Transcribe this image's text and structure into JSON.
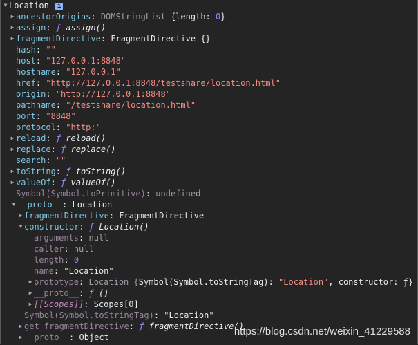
{
  "header": {
    "title": "Location",
    "badge": "i"
  },
  "own_props": [
    {
      "key": "ancestorOrigins",
      "type": "obj",
      "value": "DOMStringList {length: 0}"
    },
    {
      "key": "assign",
      "type": "fn",
      "fn_kw": "ƒ",
      "fn_sig": "assign()"
    },
    {
      "key": "fragmentDirective",
      "type": "obj",
      "value": "FragmentDirective {}"
    },
    {
      "key": "hash",
      "type": "str",
      "value": "\"\""
    },
    {
      "key": "host",
      "type": "str",
      "value": "\"127.0.0.1:8848\""
    },
    {
      "key": "hostname",
      "type": "str",
      "value": "\"127.0.0.1\""
    },
    {
      "key": "href",
      "type": "str",
      "value": "\"http://127.0.0.1:8848/testshare/location.html\""
    },
    {
      "key": "origin",
      "type": "str",
      "value": "\"http://127.0.0.1:8848\""
    },
    {
      "key": "pathname",
      "type": "str",
      "value": "\"/testshare/location.html\""
    },
    {
      "key": "port",
      "type": "str",
      "value": "\"8848\""
    },
    {
      "key": "protocol",
      "type": "str",
      "value": "\"http:\""
    },
    {
      "key": "reload",
      "type": "fn",
      "fn_kw": "ƒ",
      "fn_sig": "reload()"
    },
    {
      "key": "replace",
      "type": "fn",
      "fn_kw": "ƒ",
      "fn_sig": "replace()"
    },
    {
      "key": "search",
      "type": "str",
      "value": "\"\""
    },
    {
      "key": "toString",
      "type": "fn",
      "fn_kw": "ƒ",
      "fn_sig": "toString()"
    },
    {
      "key": "valueOf",
      "type": "fn",
      "fn_kw": "ƒ",
      "fn_sig": "valueOf()"
    },
    {
      "key": "Symbol(Symbol.toPrimitive)",
      "type": "undef",
      "value": "undefined"
    }
  ],
  "proto": {
    "key": "__proto__",
    "value": "Location",
    "fragmentDirective": {
      "key": "fragmentDirective",
      "value": "FragmentDirective"
    },
    "constructor": {
      "key": "constructor",
      "fn_kw": "ƒ",
      "fn_sig": "Location()",
      "arguments": {
        "key": "arguments",
        "value": "null"
      },
      "caller": {
        "key": "caller",
        "value": "null"
      },
      "length": {
        "key": "length",
        "value": "0"
      },
      "name": {
        "key": "name",
        "value": "\"Location\""
      },
      "prototype": {
        "key": "prototype",
        "value_head": "Location {",
        "value_sym": "Symbol(Symbol.toStringTag)",
        "value_str": "\"Location\"",
        "value_tail": ", constructor: ƒ}"
      },
      "proto": {
        "key": "__proto__",
        "fn_kw": "ƒ",
        "fn_sig": "()"
      },
      "scopes": {
        "key": "[[Scopes]]",
        "value": "Scopes[0]"
      }
    },
    "toStringTag": {
      "key": "Symbol(Symbol.toStringTag)",
      "value": "\"Location\""
    },
    "getter": {
      "label": "get fragmentDirective",
      "fn_kw": "ƒ",
      "fn_sig": "fragmentDirective()"
    },
    "proto2": {
      "key": "__proto__",
      "value": "Object"
    }
  },
  "watermark": "https://blog.csdn.net/weixin_41229588"
}
